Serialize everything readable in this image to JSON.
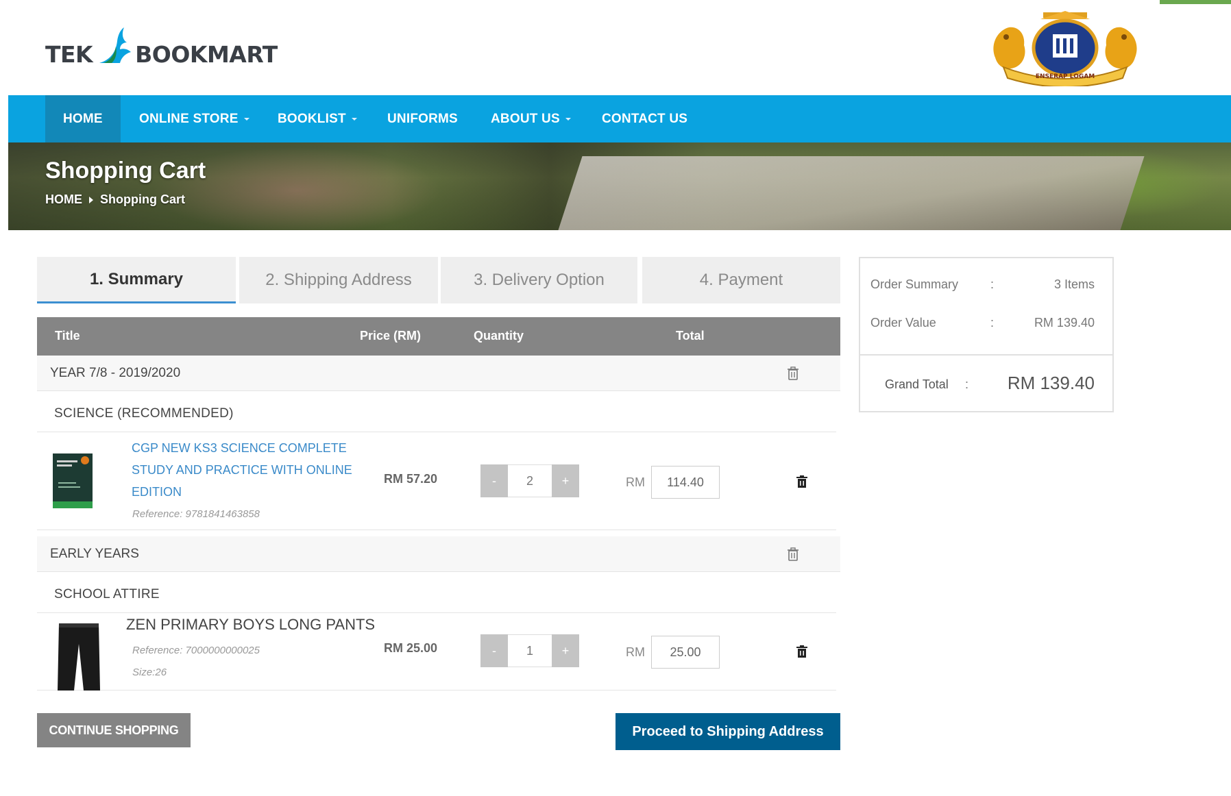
{
  "brand": {
    "left": "TEK",
    "right": "BOOKMART"
  },
  "crest": {
    "ribbon_text": "ENSERAP LOGAM"
  },
  "nav": {
    "items": [
      {
        "label": "HOME",
        "has_caret": false
      },
      {
        "label": "ONLINE STORE",
        "has_caret": true
      },
      {
        "label": "BOOKLIST",
        "has_caret": true
      },
      {
        "label": "UNIFORMS",
        "has_caret": false
      },
      {
        "label": "ABOUT US",
        "has_caret": true
      },
      {
        "label": "CONTACT US",
        "has_caret": false
      }
    ]
  },
  "hero": {
    "title": "Shopping Cart",
    "breadcrumb_home": "HOME",
    "breadcrumb_current": "Shopping Cart"
  },
  "steps": [
    {
      "label": "1. Summary",
      "active": true
    },
    {
      "label": "2. Shipping Address",
      "active": false
    },
    {
      "label": "3. Delivery Option",
      "active": false
    },
    {
      "label": "4. Payment",
      "active": false
    }
  ],
  "table": {
    "headers": {
      "title": "Title",
      "price": "Price (RM)",
      "quantity": "Quantity",
      "total": "Total"
    }
  },
  "groups": [
    {
      "name": "YEAR 7/8 - 2019/2020",
      "subgroup": "SCIENCE (RECOMMENDED)",
      "item": {
        "title_lines": [
          "CGP NEW KS3 SCIENCE COMPLETE",
          "STUDY AND PRACTICE WITH ONLINE",
          "EDITION"
        ],
        "reference": "Reference: 9781841463858",
        "price": "RM 57.20",
        "quantity": "2",
        "currency": "RM",
        "total": "114.40"
      }
    },
    {
      "name": "EARLY YEARS",
      "subgroup": "SCHOOL ATTIRE",
      "item": {
        "title": "ZEN PRIMARY BOYS LONG PANTS",
        "reference": "Reference: 7000000000025",
        "size": "Size:26",
        "price": "RM 25.00",
        "quantity": "1",
        "currency": "RM",
        "total": "25.00"
      }
    }
  ],
  "qty_controls": {
    "minus": "-",
    "plus": "+"
  },
  "buttons": {
    "continue": "CONTINUE SHOPPING",
    "proceed": "Proceed to Shipping Address"
  },
  "summary": {
    "order_summary_label": "Order Summary",
    "order_summary_value": "3 Items",
    "order_value_label": "Order Value",
    "order_value_value": "RM 139.40",
    "separator": ":",
    "grand_total_label": "Grand Total",
    "grand_total_value": "RM 139.40"
  },
  "colors": {
    "nav_bg": "#0aa3e0",
    "nav_active": "#1288b8",
    "link": "#3a8ac9",
    "proceed_bg": "#005e8e",
    "header_gray": "#858585"
  }
}
